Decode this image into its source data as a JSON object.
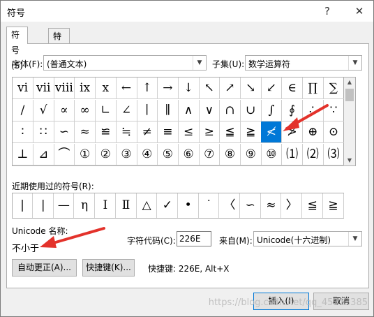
{
  "window": {
    "title": "符号",
    "help": "?",
    "close": "✕"
  },
  "tabs": [
    {
      "label": "符号(S)"
    },
    {
      "label": "特殊字符(P)"
    }
  ],
  "font": {
    "label": "字体(F):",
    "value": "(普通文本)"
  },
  "subset": {
    "label": "子集(U):",
    "value": "数学运算符"
  },
  "symbols": [
    [
      "ⅵ",
      "ⅶ",
      "ⅷ",
      "ⅸ",
      "ⅹ",
      "←",
      "↑",
      "→",
      "↓",
      "↖",
      "↗",
      "↘",
      "↙",
      "∈",
      "∏",
      "∑"
    ],
    [
      "∕",
      "√",
      "∝",
      "∞",
      "∟",
      "∠",
      "∣",
      "∥",
      "∧",
      "∨",
      "∩",
      "∪",
      "∫",
      "∮",
      "∴",
      "∵"
    ],
    [
      "∶",
      "∷",
      "∽",
      "≈",
      "≌",
      "≒",
      "≠",
      "≡",
      "≤",
      "≥",
      "≦",
      "≧",
      "≮",
      "≯",
      "⊕",
      "⊙"
    ],
    [
      "⊥",
      "⊿",
      "⌒",
      "①",
      "②",
      "③",
      "④",
      "⑤",
      "⑥",
      "⑦",
      "⑧",
      "⑨",
      "⑩",
      "⑴",
      "⑵",
      "⑶"
    ]
  ],
  "selected": {
    "row": 2,
    "col": 12
  },
  "recent": {
    "label": "近期使用过的符号(R):",
    "items": [
      "|",
      "|",
      "—",
      "η",
      "Ⅰ",
      "Ⅱ",
      "△",
      "✓",
      "•",
      "˙",
      "〈",
      "∽",
      "≈",
      "〉",
      "≦",
      "≧"
    ]
  },
  "unicode_name": {
    "label": "Unicode 名称:",
    "value": "不小于"
  },
  "char_code": {
    "label": "字符代码(C):",
    "value": "226E"
  },
  "from": {
    "label": "来自(M):",
    "value": "Unicode(十六进制)"
  },
  "buttons": {
    "autocorrect": "自动更正(A)...",
    "shortcut_key": "快捷键(K)...",
    "insert": "插入(I)",
    "cancel": "取消"
  },
  "shortcut_text": "快捷键: 226E, Alt+X",
  "watermark": "https://blog.csdn.net/qq_45213385",
  "colors": {
    "accent": "#0078d7",
    "arrow": "#e3322b"
  }
}
